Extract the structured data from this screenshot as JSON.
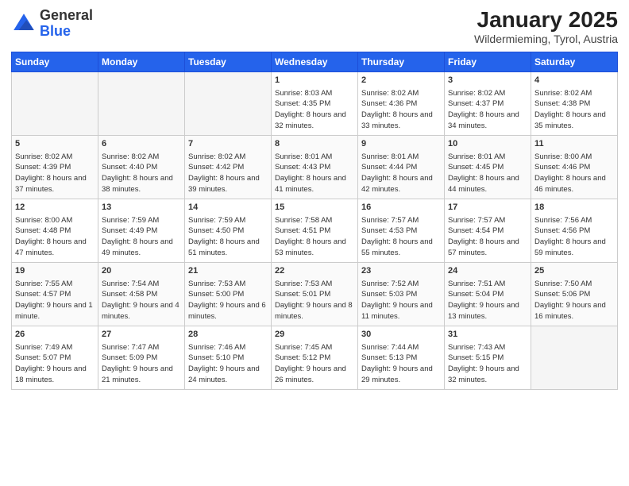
{
  "logo": {
    "text_general": "General",
    "text_blue": "Blue"
  },
  "header": {
    "month": "January 2025",
    "location": "Wildermieming, Tyrol, Austria"
  },
  "weekdays": [
    "Sunday",
    "Monday",
    "Tuesday",
    "Wednesday",
    "Thursday",
    "Friday",
    "Saturday"
  ],
  "weeks": [
    [
      {
        "day": "",
        "empty": true
      },
      {
        "day": "",
        "empty": true
      },
      {
        "day": "",
        "empty": true
      },
      {
        "day": "1",
        "sunrise": "8:03 AM",
        "sunset": "4:35 PM",
        "daylight": "8 hours and 32 minutes."
      },
      {
        "day": "2",
        "sunrise": "8:02 AM",
        "sunset": "4:36 PM",
        "daylight": "8 hours and 33 minutes."
      },
      {
        "day": "3",
        "sunrise": "8:02 AM",
        "sunset": "4:37 PM",
        "daylight": "8 hours and 34 minutes."
      },
      {
        "day": "4",
        "sunrise": "8:02 AM",
        "sunset": "4:38 PM",
        "daylight": "8 hours and 35 minutes."
      }
    ],
    [
      {
        "day": "5",
        "sunrise": "8:02 AM",
        "sunset": "4:39 PM",
        "daylight": "8 hours and 37 minutes."
      },
      {
        "day": "6",
        "sunrise": "8:02 AM",
        "sunset": "4:40 PM",
        "daylight": "8 hours and 38 minutes."
      },
      {
        "day": "7",
        "sunrise": "8:02 AM",
        "sunset": "4:42 PM",
        "daylight": "8 hours and 39 minutes."
      },
      {
        "day": "8",
        "sunrise": "8:01 AM",
        "sunset": "4:43 PM",
        "daylight": "8 hours and 41 minutes."
      },
      {
        "day": "9",
        "sunrise": "8:01 AM",
        "sunset": "4:44 PM",
        "daylight": "8 hours and 42 minutes."
      },
      {
        "day": "10",
        "sunrise": "8:01 AM",
        "sunset": "4:45 PM",
        "daylight": "8 hours and 44 minutes."
      },
      {
        "day": "11",
        "sunrise": "8:00 AM",
        "sunset": "4:46 PM",
        "daylight": "8 hours and 46 minutes."
      }
    ],
    [
      {
        "day": "12",
        "sunrise": "8:00 AM",
        "sunset": "4:48 PM",
        "daylight": "8 hours and 47 minutes."
      },
      {
        "day": "13",
        "sunrise": "7:59 AM",
        "sunset": "4:49 PM",
        "daylight": "8 hours and 49 minutes."
      },
      {
        "day": "14",
        "sunrise": "7:59 AM",
        "sunset": "4:50 PM",
        "daylight": "8 hours and 51 minutes."
      },
      {
        "day": "15",
        "sunrise": "7:58 AM",
        "sunset": "4:51 PM",
        "daylight": "8 hours and 53 minutes."
      },
      {
        "day": "16",
        "sunrise": "7:57 AM",
        "sunset": "4:53 PM",
        "daylight": "8 hours and 55 minutes."
      },
      {
        "day": "17",
        "sunrise": "7:57 AM",
        "sunset": "4:54 PM",
        "daylight": "8 hours and 57 minutes."
      },
      {
        "day": "18",
        "sunrise": "7:56 AM",
        "sunset": "4:56 PM",
        "daylight": "8 hours and 59 minutes."
      }
    ],
    [
      {
        "day": "19",
        "sunrise": "7:55 AM",
        "sunset": "4:57 PM",
        "daylight": "9 hours and 1 minute."
      },
      {
        "day": "20",
        "sunrise": "7:54 AM",
        "sunset": "4:58 PM",
        "daylight": "9 hours and 4 minutes."
      },
      {
        "day": "21",
        "sunrise": "7:53 AM",
        "sunset": "5:00 PM",
        "daylight": "9 hours and 6 minutes."
      },
      {
        "day": "22",
        "sunrise": "7:53 AM",
        "sunset": "5:01 PM",
        "daylight": "9 hours and 8 minutes."
      },
      {
        "day": "23",
        "sunrise": "7:52 AM",
        "sunset": "5:03 PM",
        "daylight": "9 hours and 11 minutes."
      },
      {
        "day": "24",
        "sunrise": "7:51 AM",
        "sunset": "5:04 PM",
        "daylight": "9 hours and 13 minutes."
      },
      {
        "day": "25",
        "sunrise": "7:50 AM",
        "sunset": "5:06 PM",
        "daylight": "9 hours and 16 minutes."
      }
    ],
    [
      {
        "day": "26",
        "sunrise": "7:49 AM",
        "sunset": "5:07 PM",
        "daylight": "9 hours and 18 minutes."
      },
      {
        "day": "27",
        "sunrise": "7:47 AM",
        "sunset": "5:09 PM",
        "daylight": "9 hours and 21 minutes."
      },
      {
        "day": "28",
        "sunrise": "7:46 AM",
        "sunset": "5:10 PM",
        "daylight": "9 hours and 24 minutes."
      },
      {
        "day": "29",
        "sunrise": "7:45 AM",
        "sunset": "5:12 PM",
        "daylight": "9 hours and 26 minutes."
      },
      {
        "day": "30",
        "sunrise": "7:44 AM",
        "sunset": "5:13 PM",
        "daylight": "9 hours and 29 minutes."
      },
      {
        "day": "31",
        "sunrise": "7:43 AM",
        "sunset": "5:15 PM",
        "daylight": "9 hours and 32 minutes."
      },
      {
        "day": "",
        "empty": true
      }
    ]
  ]
}
